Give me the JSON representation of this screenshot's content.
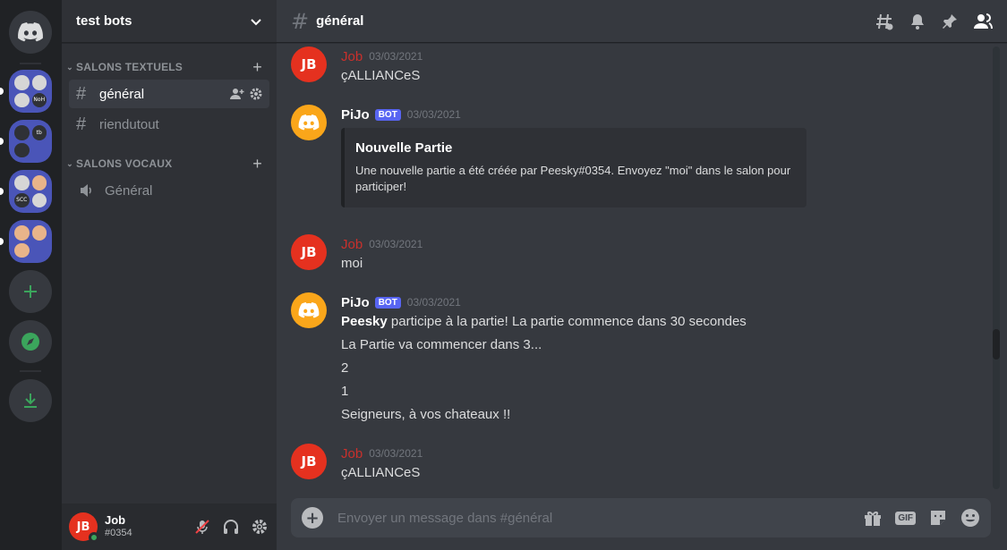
{
  "server_rail": {
    "folders": [
      {
        "tiles": [
          "",
          "",
          "",
          "NoH"
        ]
      },
      {
        "tiles": [
          "",
          "tb",
          "",
          ""
        ]
      },
      {
        "tiles": [
          "",
          "",
          "SCC",
          ""
        ]
      },
      {
        "tiles": [
          "",
          "",
          "",
          ""
        ]
      }
    ]
  },
  "guild": {
    "name": "test bots"
  },
  "categories": {
    "text": "SALONS TEXTUELS",
    "voice": "SALONS VOCAUX"
  },
  "channels": {
    "text": [
      {
        "name": "général",
        "active": true
      },
      {
        "name": "riendutout",
        "active": false
      }
    ],
    "voice": [
      {
        "name": "Général"
      }
    ]
  },
  "user": {
    "name": "Job",
    "tag": "#0354",
    "avatar_text": "JB"
  },
  "topbar": {
    "channel_title": "général"
  },
  "messages": [
    {
      "author": "Job",
      "author_type": "job",
      "timestamp": "03/03/2021",
      "lines": [
        "çALLIANCeS"
      ]
    },
    {
      "author": "PiJo",
      "author_type": "pijo",
      "bot_label": "BOT",
      "timestamp": "03/03/2021",
      "embed": {
        "title": "Nouvelle Partie",
        "description": "Une nouvelle partie a été créée par Peesky#0354. Envoyez \"moi\" dans le salon pour participer!"
      }
    },
    {
      "author": "Job",
      "author_type": "job",
      "timestamp": "03/03/2021",
      "lines": [
        "moi"
      ]
    },
    {
      "author": "PiJo",
      "author_type": "pijo",
      "bot_label": "BOT",
      "timestamp": "03/03/2021",
      "first_line": {
        "bold": "Peesky",
        "rest": " participe à la partie! La partie commence dans 30 secondes"
      },
      "lines": [
        "La Partie va commencer dans 3...",
        "2",
        "1",
        "Seigneurs, à vos chateaux !!"
      ]
    },
    {
      "author": "Job",
      "author_type": "job",
      "timestamp": "03/03/2021",
      "lines": [
        "çALLIANCeS"
      ]
    }
  ],
  "composer": {
    "placeholder": "Envoyer un message dans #général",
    "gif_label": "GIF"
  },
  "colors": {
    "accent": "#5865f2",
    "job_red": "#e5311f",
    "bot_orange": "#faa61a",
    "online_green": "#3ba55c"
  }
}
